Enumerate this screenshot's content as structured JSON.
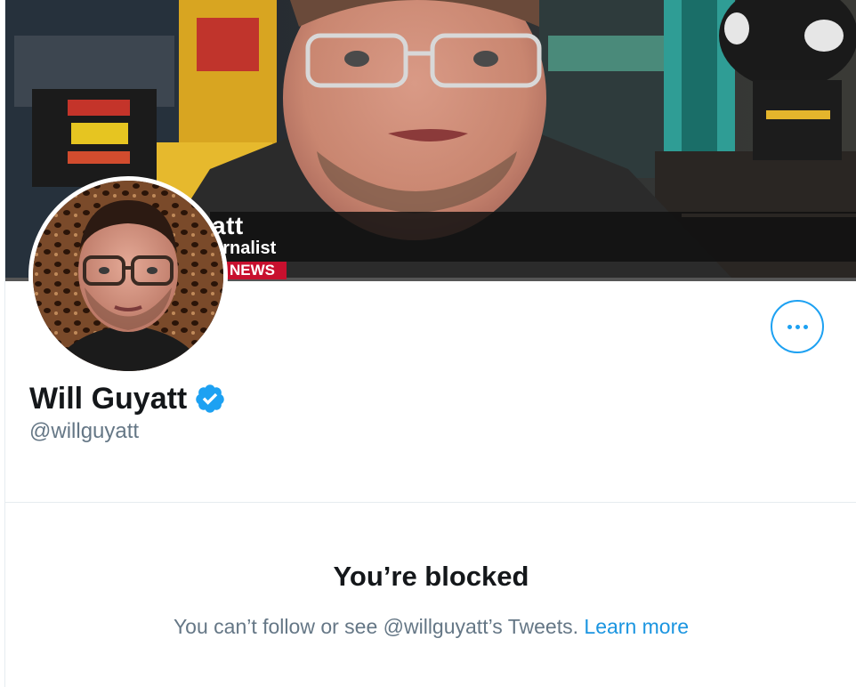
{
  "banner": {
    "lower_third_name": "att",
    "lower_third_role": "urnalist",
    "lower_third_network": "NEWS"
  },
  "profile": {
    "display_name": "Will Guyatt",
    "handle": "@willguyatt",
    "verified": true
  },
  "actions": {
    "more_icon": "more-horizontal-icon"
  },
  "blocked_notice": {
    "title": "You’re blocked",
    "message": "You can’t follow or see @willguyatt’s Tweets.",
    "link_label": "Learn more"
  },
  "colors": {
    "accent": "#1da1f2",
    "link": "#1b95e0",
    "text_primary": "#14171a",
    "text_secondary": "#657786",
    "border": "#e6ecf0"
  }
}
